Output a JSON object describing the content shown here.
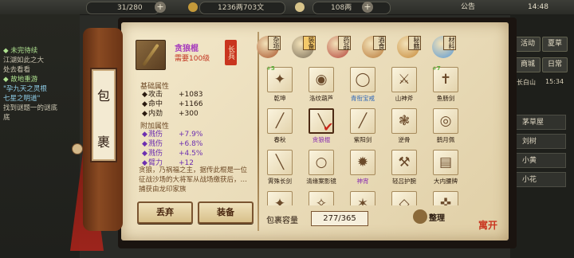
{
  "topbar": {
    "energy": "31/280",
    "money": "1236两703文",
    "ingot": "108两",
    "announce": "公告",
    "time": "14:48"
  },
  "left_panel": {
    "quests": [
      {
        "text": "◆ 未完待续",
        "style": "h"
      },
      {
        "text": "江湖如此之大",
        "style": ""
      },
      {
        "text": "处去看看",
        "style": ""
      },
      {
        "text": "◆ 故地重游",
        "style": "h"
      },
      {
        "text": "\"孕九天之灵根",
        "style": "b"
      },
      {
        "text": "七星之明道\"",
        "style": "b"
      },
      {
        "text": "找到谜题一的谜底",
        "style": ""
      },
      {
        "text": "底",
        "style": ""
      }
    ]
  },
  "right_panel": {
    "buttons": [
      [
        "活动",
        "夏草"
      ],
      [
        "商城",
        "日常"
      ]
    ],
    "location": "长白山",
    "loc_time": "15:34",
    "list": [
      "茅草屋",
      "刘树",
      "小黄",
      "小花"
    ]
  },
  "scroll_tab": [
    "包",
    "裹"
  ],
  "detail": {
    "name": "贪狼棍",
    "req": "需要100级",
    "seal": "长兵",
    "base_title": "基础属性",
    "base_stats": [
      {
        "k": "攻击",
        "v": "+1083"
      },
      {
        "k": "命中",
        "v": "+1166"
      },
      {
        "k": "内劲",
        "v": "+300"
      }
    ],
    "extra_title": "附加属性",
    "extra_stats": [
      {
        "k": "溅伤",
        "v": "+7.9%"
      },
      {
        "k": "溅伤",
        "v": "+6.8%"
      },
      {
        "k": "溅伤",
        "v": "+4.5%"
      },
      {
        "k": "臂力",
        "v": "+12"
      }
    ],
    "description": "贪狼，乃祸福之主，据传此棍是一位征战沙场的大将军从战场缴获后，…捕获由龙印家族"
  },
  "buttons": {
    "discard": "丢弃",
    "equip": "装备"
  },
  "categories": [
    {
      "label": "杂项",
      "color": "#a8542c",
      "icon": "misc-icon"
    },
    {
      "label": "装备",
      "color": "#7b6f5a",
      "icon": "equip-icon"
    },
    {
      "label": "药品",
      "color": "#b3433a",
      "icon": "medicine-icon"
    },
    {
      "label": "酒食",
      "color": "#b87a3a",
      "icon": "food-icon"
    },
    {
      "label": "秘籍",
      "color": "#c68a3a",
      "icon": "book-icon"
    },
    {
      "label": "材料",
      "color": "#5b9ad4",
      "icon": "material-icon"
    }
  ],
  "active_category": 1,
  "inventory": [
    {
      "name": "乾坤",
      "glyph": "✦",
      "tag": "+5",
      "color": ""
    },
    {
      "name": "洛纹葫芦",
      "glyph": "◉",
      "tag": "",
      "color": ""
    },
    {
      "name": "青衔宝戒",
      "glyph": "◯",
      "tag": "",
      "color": "b"
    },
    {
      "name": "山神斧",
      "glyph": "⚔",
      "tag": "",
      "color": ""
    },
    {
      "name": "鱼肠剑",
      "glyph": "✝",
      "tag": "+7",
      "color": ""
    },
    {
      "name": "春秋",
      "glyph": "╱",
      "tag": "",
      "color": ""
    },
    {
      "name": "贪狼棍",
      "glyph": "╲",
      "tag": "",
      "color": "p"
    },
    {
      "name": "紫阳剑",
      "glyph": "╱",
      "tag": "",
      "color": ""
    },
    {
      "name": "逆骨",
      "glyph": "❃",
      "tag": "",
      "color": ""
    },
    {
      "name": "鹤月佩",
      "glyph": "◎",
      "tag": "",
      "color": ""
    },
    {
      "name": "霄殊长剑",
      "glyph": "╲",
      "tag": "",
      "color": ""
    },
    {
      "name": "清缘案影镜",
      "glyph": "○",
      "tag": "",
      "color": ""
    },
    {
      "name": "神宵",
      "glyph": "✹",
      "tag": "",
      "color": "p"
    },
    {
      "name": "轻吕护腕",
      "glyph": "⚒",
      "tag": "",
      "color": ""
    },
    {
      "name": "大内腰牌",
      "glyph": "▤",
      "tag": "",
      "color": ""
    },
    {
      "name": "",
      "glyph": "✦",
      "tag": "",
      "color": ""
    },
    {
      "name": "",
      "glyph": "✧",
      "tag": "",
      "color": ""
    },
    {
      "name": "",
      "glyph": "✶",
      "tag": "",
      "color": ""
    },
    {
      "name": "",
      "glyph": "◇",
      "tag": "",
      "color": ""
    },
    {
      "name": "",
      "glyph": "✜",
      "tag": "",
      "color": ""
    }
  ],
  "selected_index": 6,
  "capacity": {
    "label": "包裹容量",
    "value": "277/365"
  },
  "sort_label": "整理",
  "logo": "寓开"
}
